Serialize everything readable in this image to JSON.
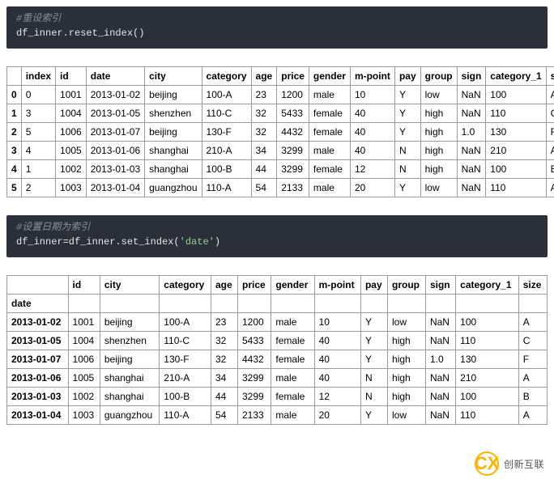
{
  "code1": {
    "comment": "#重设索引",
    "line": "df_inner.reset_index()"
  },
  "code2": {
    "comment": "#设置日期为索引",
    "line_a": "df_inner=df_inner.set_index(",
    "line_str": "'date'",
    "line_b": ")"
  },
  "table1": {
    "headers": [
      "",
      "index",
      "id",
      "date",
      "city",
      "category",
      "age",
      "price",
      "gender",
      "m-point",
      "pay",
      "group",
      "sign",
      "category_1",
      "size"
    ],
    "rows": [
      [
        "0",
        "0",
        "1001",
        "2013-01-02",
        "beijing",
        "100-A",
        "23",
        "1200",
        "male",
        "10",
        "Y",
        "low",
        "NaN",
        "100",
        "A"
      ],
      [
        "1",
        "3",
        "1004",
        "2013-01-05",
        "shenzhen",
        "110-C",
        "32",
        "5433",
        "female",
        "40",
        "Y",
        "high",
        "NaN",
        "110",
        "C"
      ],
      [
        "2",
        "5",
        "1006",
        "2013-01-07",
        "beijing",
        "130-F",
        "32",
        "4432",
        "female",
        "40",
        "Y",
        "high",
        "1.0",
        "130",
        "F"
      ],
      [
        "3",
        "4",
        "1005",
        "2013-01-06",
        "shanghai",
        "210-A",
        "34",
        "3299",
        "male",
        "40",
        "N",
        "high",
        "NaN",
        "210",
        "A"
      ],
      [
        "4",
        "1",
        "1002",
        "2013-01-03",
        "shanghai",
        "100-B",
        "44",
        "3299",
        "female",
        "12",
        "N",
        "high",
        "NaN",
        "100",
        "B"
      ],
      [
        "5",
        "2",
        "1003",
        "2013-01-04",
        "guangzhou",
        "110-A",
        "54",
        "2133",
        "male",
        "20",
        "Y",
        "low",
        "NaN",
        "110",
        "A"
      ]
    ]
  },
  "table2": {
    "headers": [
      "",
      "id",
      "city",
      "category",
      "age",
      "price",
      "gender",
      "m-point",
      "pay",
      "group",
      "sign",
      "category_1",
      "size"
    ],
    "index_name": "date",
    "rows": [
      [
        "2013-01-02",
        "1001",
        "beijing",
        "100-A",
        "23",
        "1200",
        "male",
        "10",
        "Y",
        "low",
        "NaN",
        "100",
        "A"
      ],
      [
        "2013-01-05",
        "1004",
        "shenzhen",
        "110-C",
        "32",
        "5433",
        "female",
        "40",
        "Y",
        "high",
        "NaN",
        "110",
        "C"
      ],
      [
        "2013-01-07",
        "1006",
        "beijing",
        "130-F",
        "32",
        "4432",
        "female",
        "40",
        "Y",
        "high",
        "1.0",
        "130",
        "F"
      ],
      [
        "2013-01-06",
        "1005",
        "shanghai",
        "210-A",
        "34",
        "3299",
        "male",
        "40",
        "N",
        "high",
        "NaN",
        "210",
        "A"
      ],
      [
        "2013-01-03",
        "1002",
        "shanghai",
        "100-B",
        "44",
        "3299",
        "female",
        "12",
        "N",
        "high",
        "NaN",
        "100",
        "B"
      ],
      [
        "2013-01-04",
        "1003",
        "guangzhou",
        "110-A",
        "54",
        "2133",
        "male",
        "20",
        "Y",
        "low",
        "NaN",
        "110",
        "A"
      ]
    ]
  },
  "watermark": {
    "icon": "CX",
    "text": "创新互联"
  },
  "chart_data": {
    "type": "table",
    "tables": [
      {
        "title": "df_inner.reset_index()",
        "columns": [
          "index",
          "id",
          "date",
          "city",
          "category",
          "age",
          "price",
          "gender",
          "m-point",
          "pay",
          "group",
          "sign",
          "category_1",
          "size"
        ],
        "index": [
          0,
          1,
          2,
          3,
          4,
          5
        ],
        "data": [
          [
            0,
            1001,
            "2013-01-02",
            "beijing",
            "100-A",
            23,
            1200,
            "male",
            10,
            "Y",
            "low",
            "NaN",
            100,
            "A"
          ],
          [
            3,
            1004,
            "2013-01-05",
            "shenzhen",
            "110-C",
            32,
            5433,
            "female",
            40,
            "Y",
            "high",
            "NaN",
            110,
            "C"
          ],
          [
            5,
            1006,
            "2013-01-07",
            "beijing",
            "130-F",
            32,
            4432,
            "female",
            40,
            "Y",
            "high",
            1.0,
            130,
            "F"
          ],
          [
            4,
            1005,
            "2013-01-06",
            "shanghai",
            "210-A",
            34,
            3299,
            "male",
            40,
            "N",
            "high",
            "NaN",
            210,
            "A"
          ],
          [
            1,
            1002,
            "2013-01-03",
            "shanghai",
            "100-B",
            44,
            3299,
            "female",
            12,
            "N",
            "high",
            "NaN",
            100,
            "B"
          ],
          [
            2,
            1003,
            "2013-01-04",
            "guangzhou",
            "110-A",
            54,
            2133,
            "male",
            20,
            "Y",
            "low",
            "NaN",
            110,
            "A"
          ]
        ]
      },
      {
        "title": "df_inner.set_index('date')",
        "index_name": "date",
        "columns": [
          "id",
          "city",
          "category",
          "age",
          "price",
          "gender",
          "m-point",
          "pay",
          "group",
          "sign",
          "category_1",
          "size"
        ],
        "index": [
          "2013-01-02",
          "2013-01-05",
          "2013-01-07",
          "2013-01-06",
          "2013-01-03",
          "2013-01-04"
        ],
        "data": [
          [
            1001,
            "beijing",
            "100-A",
            23,
            1200,
            "male",
            10,
            "Y",
            "low",
            "NaN",
            100,
            "A"
          ],
          [
            1004,
            "shenzhen",
            "110-C",
            32,
            5433,
            "female",
            40,
            "Y",
            "high",
            "NaN",
            110,
            "C"
          ],
          [
            1006,
            "beijing",
            "130-F",
            32,
            4432,
            "female",
            40,
            "Y",
            "high",
            1.0,
            130,
            "F"
          ],
          [
            1005,
            "shanghai",
            "210-A",
            34,
            3299,
            "male",
            40,
            "N",
            "high",
            "NaN",
            210,
            "A"
          ],
          [
            1002,
            "shanghai",
            "100-B",
            44,
            3299,
            "female",
            12,
            "N",
            "high",
            "NaN",
            100,
            "B"
          ],
          [
            1003,
            "guangzhou",
            "110-A",
            54,
            2133,
            "male",
            20,
            "Y",
            "low",
            "NaN",
            110,
            "A"
          ]
        ]
      }
    ]
  }
}
